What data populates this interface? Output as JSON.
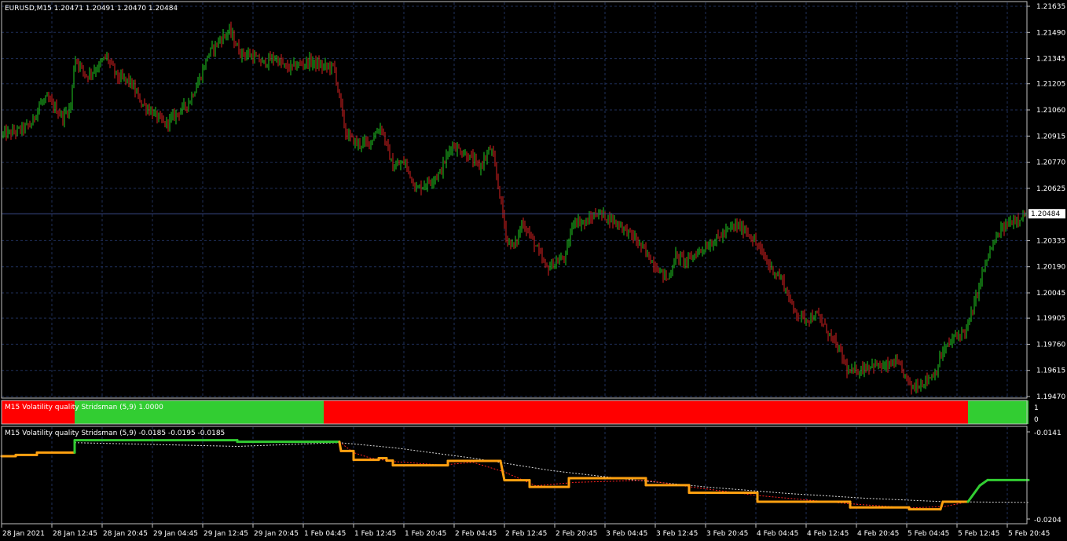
{
  "colors": {
    "background": "#000000",
    "grid": "#1f2f5a",
    "frame": "#c0c0c0",
    "bull": "#22cc22",
    "bear": "#dd2222",
    "bid_line": "#3a4a8a",
    "state_red": "#ff0000",
    "state_green": "#32cd32",
    "indicator_orange": "#ffa010",
    "indicator_green": "#32cd32",
    "signal_red": "#ff2020",
    "signal_white": "#d8d8d8"
  },
  "main": {
    "header": "EURUSD,M15  1.20471 1.20491 1.20470 1.20484",
    "price_labels": [
      "1.21635",
      "1.21490",
      "1.21345",
      "1.21205",
      "1.21060",
      "1.20915",
      "1.20770",
      "1.20625",
      "1.20335",
      "1.20190",
      "1.20045",
      "1.19905",
      "1.19760",
      "1.19615",
      "1.19470"
    ],
    "current_price": "1.20484"
  },
  "chart_data": {
    "type": "candlestick",
    "symbol": "EURUSD",
    "timeframe": "M15",
    "last_bar": {
      "open": 1.20471,
      "high": 1.20491,
      "low": 1.2047,
      "close": 1.20484
    },
    "ylim": [
      1.1947,
      1.21635
    ],
    "x_tick_labels": [
      "28 Jan 2021",
      "28 Jan 12:45",
      "28 Jan 20:45",
      "29 Jan 04:45",
      "29 Jan 12:45",
      "29 Jan 20:45",
      "1 Feb 04:45",
      "1 Feb 12:45",
      "1 Feb 20:45",
      "2 Feb 04:45",
      "2 Feb 12:45",
      "2 Feb 20:45",
      "3 Feb 04:45",
      "3 Feb 12:45",
      "3 Feb 20:45",
      "4 Feb 04:45",
      "4 Feb 12:45",
      "4 Feb 20:45",
      "5 Feb 04:45",
      "5 Feb 12:45",
      "5 Feb 20:45"
    ],
    "close_path": [
      [
        0,
        1.2092
      ],
      [
        20,
        1.2094
      ],
      [
        40,
        1.2098
      ],
      [
        50,
        1.2109
      ],
      [
        60,
        1.2112
      ],
      [
        80,
        1.2102
      ],
      [
        90,
        1.2108
      ],
      [
        95,
        1.2135
      ],
      [
        110,
        1.2125
      ],
      [
        125,
        1.213
      ],
      [
        135,
        1.2136
      ],
      [
        150,
        1.2124
      ],
      [
        165,
        1.2122
      ],
      [
        180,
        1.211
      ],
      [
        200,
        1.2102
      ],
      [
        210,
        1.2098
      ],
      [
        225,
        1.2104
      ],
      [
        240,
        1.211
      ],
      [
        255,
        1.2124
      ],
      [
        265,
        1.2137
      ],
      [
        280,
        1.2145
      ],
      [
        292,
        1.215
      ],
      [
        305,
        1.2138
      ],
      [
        320,
        1.2136
      ],
      [
        335,
        1.2132
      ],
      [
        350,
        1.2135
      ],
      [
        365,
        1.2129
      ],
      [
        380,
        1.2131
      ],
      [
        395,
        1.2133
      ],
      [
        410,
        1.213
      ],
      [
        425,
        1.213
      ],
      [
        430,
        1.2118
      ],
      [
        440,
        1.2093
      ],
      [
        455,
        1.2087
      ],
      [
        470,
        1.2088
      ],
      [
        485,
        1.2097
      ],
      [
        500,
        1.2074
      ],
      [
        515,
        1.2077
      ],
      [
        530,
        1.2062
      ],
      [
        545,
        1.2066
      ],
      [
        560,
        1.2071
      ],
      [
        575,
        1.2087
      ],
      [
        590,
        1.2082
      ],
      [
        600,
        1.2079
      ],
      [
        610,
        1.2074
      ],
      [
        625,
        1.2085
      ],
      [
        635,
        1.2062
      ],
      [
        645,
        1.2034
      ],
      [
        655,
        1.203
      ],
      [
        665,
        1.2044
      ],
      [
        680,
        1.2032
      ],
      [
        695,
        1.2018
      ],
      [
        710,
        1.2022
      ],
      [
        720,
        1.2025
      ],
      [
        730,
        1.2045
      ],
      [
        745,
        1.2043
      ],
      [
        760,
        1.2049
      ],
      [
        775,
        1.2046
      ],
      [
        790,
        1.2042
      ],
      [
        805,
        1.2036
      ],
      [
        820,
        1.2028
      ],
      [
        835,
        1.2019
      ],
      [
        850,
        1.2012
      ],
      [
        860,
        1.2025
      ],
      [
        875,
        1.2022
      ],
      [
        890,
        1.2028
      ],
      [
        905,
        1.2032
      ],
      [
        920,
        1.2037
      ],
      [
        935,
        1.2042
      ],
      [
        950,
        1.2039
      ],
      [
        965,
        1.203
      ],
      [
        980,
        1.2019
      ],
      [
        995,
        1.2012
      ],
      [
        1010,
        1.1995
      ],
      [
        1025,
        1.199
      ],
      [
        1040,
        1.1992
      ],
      [
        1055,
        1.1982
      ],
      [
        1070,
        1.1971
      ],
      [
        1080,
        1.196
      ],
      [
        1095,
        1.1962
      ],
      [
        1110,
        1.1965
      ],
      [
        1125,
        1.1963
      ],
      [
        1140,
        1.1966
      ],
      [
        1150,
        1.196
      ],
      [
        1160,
        1.1952
      ],
      [
        1175,
        1.1955
      ],
      [
        1190,
        1.196
      ],
      [
        1200,
        1.1972
      ],
      [
        1215,
        1.198
      ],
      [
        1230,
        1.1984
      ],
      [
        1240,
        1.1998
      ],
      [
        1250,
        1.2015
      ],
      [
        1260,
        1.2028
      ],
      [
        1275,
        1.204
      ],
      [
        1290,
        1.2045
      ],
      [
        1305,
        1.2048
      ]
    ]
  },
  "volatility_bar": {
    "label": "M15 Volatility quality Stridsman (5,9) 1.0000",
    "scale_labels": [
      "1",
      "0"
    ],
    "segments": [
      {
        "from": 0,
        "to": 93,
        "state": "red"
      },
      {
        "from": 93,
        "to": 410,
        "state": "green"
      },
      {
        "from": 410,
        "to": 1230,
        "state": "red"
      },
      {
        "from": 1230,
        "to": 1307,
        "state": "green"
      }
    ]
  },
  "volatility_line": {
    "label": "M15 Volatility quality Stridsman (5,9) -0.0185 -0.0195 -0.0185",
    "scale_labels": [
      "-0.0141",
      "-0.0204"
    ],
    "ylim": [
      -0.0204,
      -0.0141
    ],
    "main_steps": [
      [
        0,
        -0.01586
      ],
      [
        18,
        -0.01586
      ],
      [
        18,
        -0.01577
      ],
      [
        45,
        -0.01577
      ],
      [
        45,
        -0.0156
      ],
      [
        93,
        -0.0156
      ],
      [
        93,
        -0.0147
      ],
      [
        300,
        -0.0147
      ],
      [
        300,
        -0.01482
      ],
      [
        430,
        -0.01482
      ],
      [
        432,
        -0.01548
      ],
      [
        448,
        -0.01548
      ],
      [
        448,
        -0.01612
      ],
      [
        480,
        -0.01612
      ],
      [
        480,
        -0.016
      ],
      [
        490,
        -0.016
      ],
      [
        490,
        -0.01618
      ],
      [
        498,
        -0.01618
      ],
      [
        498,
        -0.01652
      ],
      [
        568,
        -0.01652
      ],
      [
        568,
        -0.0162
      ],
      [
        635,
        -0.0162
      ],
      [
        640,
        -0.0176
      ],
      [
        672,
        -0.0176
      ],
      [
        672,
        -0.01808
      ],
      [
        722,
        -0.01808
      ],
      [
        722,
        -0.01745
      ],
      [
        820,
        -0.01745
      ],
      [
        820,
        -0.01795
      ],
      [
        875,
        -0.01795
      ],
      [
        875,
        -0.0185
      ],
      [
        962,
        -0.0185
      ],
      [
        962,
        -0.01915
      ],
      [
        1080,
        -0.01915
      ],
      [
        1080,
        -0.01956
      ],
      [
        1155,
        -0.01956
      ],
      [
        1155,
        -0.0197
      ],
      [
        1195,
        -0.0197
      ],
      [
        1198,
        -0.01915
      ],
      [
        1230,
        -0.01915
      ],
      [
        1245,
        -0.01798
      ],
      [
        1255,
        -0.01758
      ],
      [
        1307,
        -0.01758
      ]
    ],
    "signal_red": [
      [
        430,
        -0.01482
      ],
      [
        448,
        -0.0156
      ],
      [
        470,
        -0.016
      ],
      [
        500,
        -0.01625
      ],
      [
        560,
        -0.0165
      ],
      [
        600,
        -0.0163
      ],
      [
        640,
        -0.017
      ],
      [
        680,
        -0.018
      ],
      [
        730,
        -0.01775
      ],
      [
        820,
        -0.0176
      ],
      [
        880,
        -0.0181
      ],
      [
        962,
        -0.0187
      ],
      [
        1080,
        -0.0193
      ],
      [
        1155,
        -0.0196
      ],
      [
        1200,
        -0.0195
      ],
      [
        1230,
        -0.01915
      ]
    ],
    "signal_white": [
      [
        93,
        -0.01488
      ],
      [
        300,
        -0.01515
      ],
      [
        430,
        -0.01488
      ],
      [
        500,
        -0.01525
      ],
      [
        600,
        -0.016
      ],
      [
        700,
        -0.0169
      ],
      [
        800,
        -0.01755
      ],
      [
        900,
        -0.0181
      ],
      [
        1000,
        -0.01855
      ],
      [
        1100,
        -0.0189
      ],
      [
        1200,
        -0.01915
      ],
      [
        1307,
        -0.0192
      ]
    ]
  }
}
